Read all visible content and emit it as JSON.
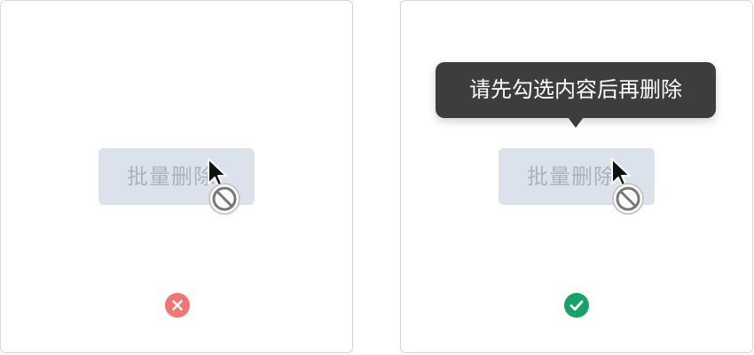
{
  "examples": [
    {
      "button_label": "批量删除",
      "button_state": "disabled",
      "cursor_icon": "not-allowed-cursor",
      "verdict_icon": "error-x-icon",
      "verdict_color": "#f27575"
    },
    {
      "button_label": "批量删除",
      "button_state": "disabled",
      "cursor_icon": "not-allowed-cursor",
      "tooltip": "请先勾选内容后再删除",
      "tooltip_bg": "#3d3d3d",
      "verdict_icon": "check-icon",
      "verdict_color": "#17a367"
    }
  ],
  "colors": {
    "disabled_button_bg": "#dce2eb",
    "disabled_button_text": "#a9b2bf",
    "panel_border": "#d6d6d6"
  }
}
